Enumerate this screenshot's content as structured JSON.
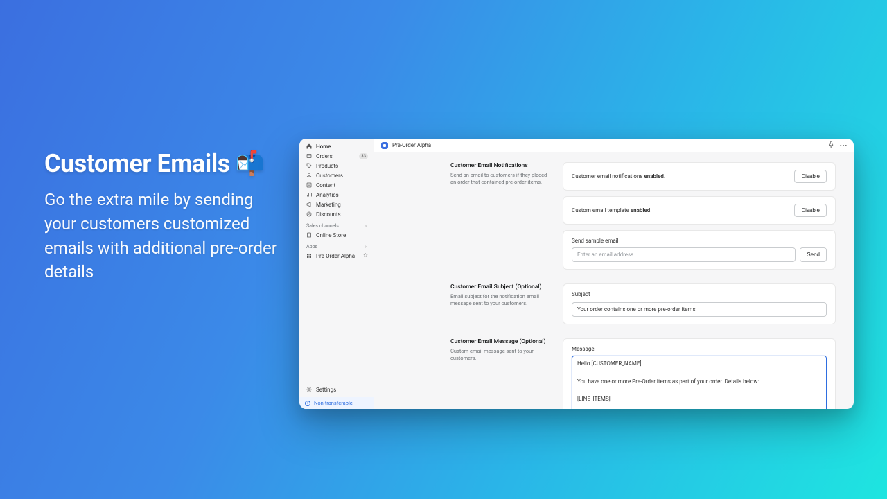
{
  "hero": {
    "title": "Customer Emails",
    "subtitle": "Go the extra mile by sending your customers customized emails with additional pre-order details"
  },
  "topbar": {
    "title": "Pre-Order Alpha"
  },
  "sidebar": {
    "items": [
      {
        "label": "Home",
        "icon": "home"
      },
      {
        "label": "Orders",
        "icon": "orders",
        "badge": "33"
      },
      {
        "label": "Products",
        "icon": "products"
      },
      {
        "label": "Customers",
        "icon": "customers"
      },
      {
        "label": "Content",
        "icon": "content"
      },
      {
        "label": "Analytics",
        "icon": "analytics"
      },
      {
        "label": "Marketing",
        "icon": "marketing"
      },
      {
        "label": "Discounts",
        "icon": "discounts"
      }
    ],
    "sales_heading": "Sales channels",
    "sales_items": [
      {
        "label": "Online Store",
        "icon": "store"
      }
    ],
    "apps_heading": "Apps",
    "apps_items": [
      {
        "label": "Pre-Order Alpha",
        "icon": "app",
        "pinned": true
      }
    ],
    "settings_label": "Settings",
    "footer_label": "Non-transferable"
  },
  "sections": {
    "notifications": {
      "title": "Customer Email Notifications",
      "desc": "Send an email to customers if they placed an order that contained pre-order items.",
      "status1_prefix": "Customer email notifications ",
      "status1_bold": "enabled",
      "status1_suffix": ".",
      "status2_prefix": "Custom email template ",
      "status2_bold": "enabled",
      "status2_suffix": ".",
      "disable_label": "Disable",
      "sample_label": "Send sample email",
      "sample_placeholder": "Enter an email address",
      "send_label": "Send"
    },
    "subject": {
      "title": "Customer Email Subject (Optional)",
      "desc": "Email subject for the notification email message sent to your customers.",
      "label": "Subject",
      "value": "Your order contains one or more pre-order items"
    },
    "message": {
      "title": "Customer Email Message (Optional)",
      "desc": "Custom email message sent to your customers.",
      "label": "Message",
      "value": "Hello [CUSTOMER_NAME]!\n\nYou have one or more Pre-Order items as part of your order. Details below:\n\n[LINE_ITEMS]\n\nWe'll ship these items separately as soon as they arrive in stock, however please contact us if you have any questions.\n\nSincerely,"
    }
  }
}
